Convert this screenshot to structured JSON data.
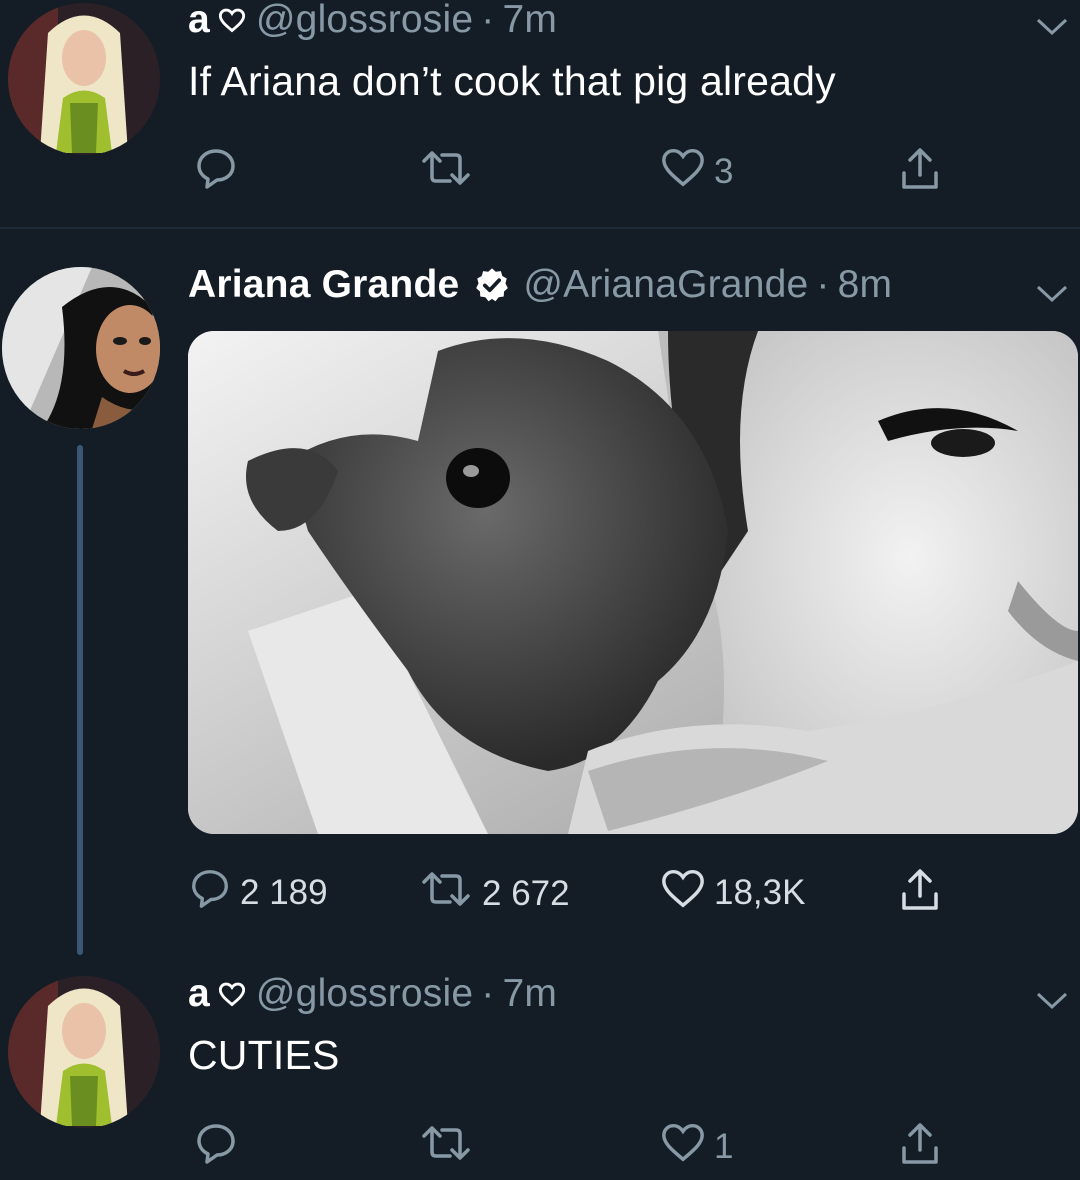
{
  "tweets": [
    {
      "display_name": "a",
      "handle": "@glossrosie",
      "separator": "·",
      "time": "7m",
      "text": "If Ariana don’t cook that pig already",
      "reply_count": "",
      "retweet_count": "",
      "like_count": "3"
    },
    {
      "display_name": "Ariana Grande",
      "handle": "@ArianaGrande",
      "separator": "·",
      "time": "8m",
      "text": "",
      "reply_count": "2 189",
      "retweet_count": "2 672",
      "like_count": "18,3K"
    },
    {
      "display_name": "a",
      "handle": "@glossrosie",
      "separator": "·",
      "time": "7m",
      "text": "CUTIES",
      "reply_count": "",
      "retweet_count": "",
      "like_count": "1"
    }
  ],
  "colors": {
    "background": "#141d26",
    "secondary_text": "#8899a6",
    "thread_line": "#3a5874"
  },
  "icons": [
    "reply-icon",
    "retweet-icon",
    "like-icon",
    "share-icon",
    "chevron-down-icon",
    "verified-badge-icon",
    "heart-outline-icon"
  ]
}
